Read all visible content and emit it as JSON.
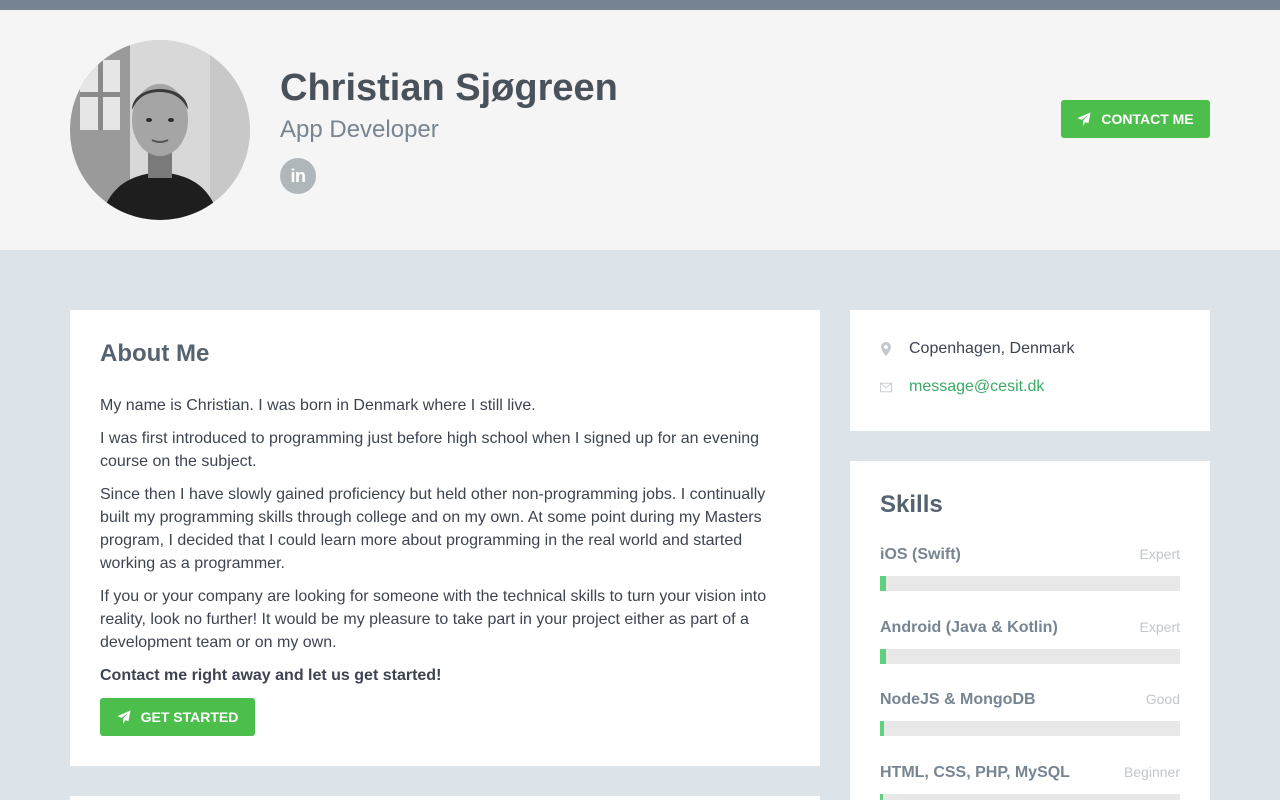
{
  "header": {
    "name": "Christian Sjøgreen",
    "tagline": "App Developer",
    "social_icon": "linkedin-icon",
    "social_label": "in",
    "contact_label": "CONTACT ME"
  },
  "about": {
    "title": "About Me",
    "paragraphs": [
      "My name is Christian. I was born in Denmark where I still live.",
      "I was first introduced to programming just before high school when I signed up for an evening course on the subject.",
      "Since then I have slowly gained proficiency but held other non-programming jobs. I continually built my programming skills through college and on my own. At some point during my Masters program, I decided that I could learn more about programming in the real world and started working as a programmer.",
      "If you or your company are looking for someone with the technical skills to turn your vision into reality, look no further! It would be my pleasure to take part in your project either as part of a development team or on my own."
    ],
    "cta_text": "Contact me right away and let us get started!",
    "button_label": "GET STARTED"
  },
  "info": {
    "location": "Copenhagen, Denmark",
    "email": "message@cesit.dk"
  },
  "skills": {
    "title": "Skills",
    "items": [
      {
        "name": "iOS (Swift)",
        "level": "Expert",
        "progress": 0.02
      },
      {
        "name": "Android (Java & Kotlin)",
        "level": "Expert",
        "progress": 0.02
      },
      {
        "name": "NodeJS & MongoDB",
        "level": "Good",
        "progress": 0.013
      },
      {
        "name": "HTML, CSS, PHP, MySQL",
        "level": "Beginner",
        "progress": 0.01
      }
    ]
  },
  "colors": {
    "topbar": "#778492",
    "button": "#4cbe4c",
    "skill_fill": "#5fcf80",
    "link": "#3aaa64"
  }
}
